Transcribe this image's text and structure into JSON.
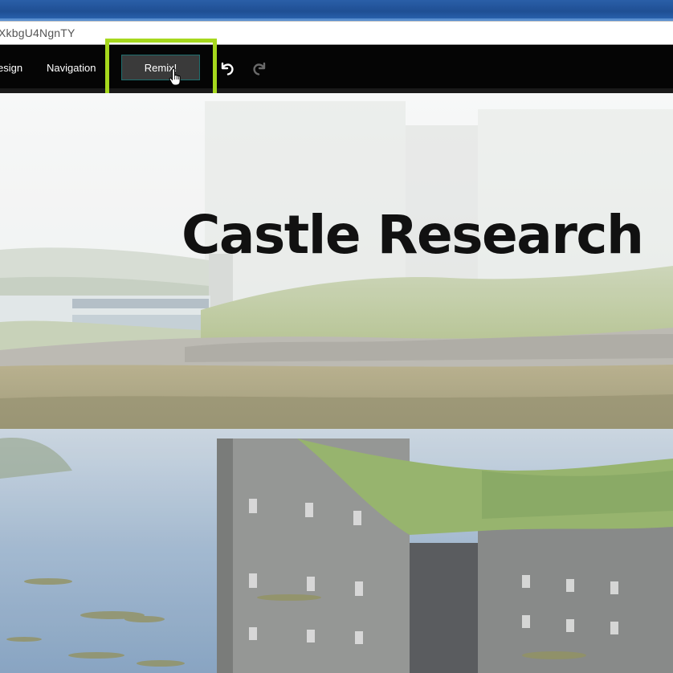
{
  "browser": {
    "address_text": "XkbgU4NgnTY"
  },
  "toolbar": {
    "design_label": "esign",
    "navigation_label": "Navigation",
    "remix_label": "Remix!",
    "undo_icon": "undo-icon",
    "redo_icon": "redo-icon",
    "highlight_color": "#a6d81d"
  },
  "hero": {
    "title": "Castle Research"
  }
}
